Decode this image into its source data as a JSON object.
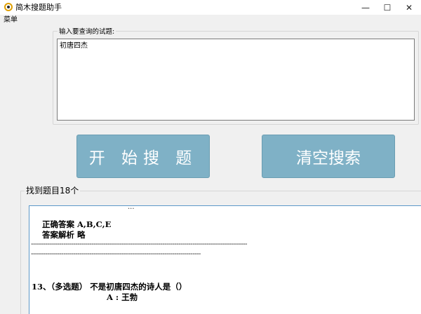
{
  "window": {
    "title": "简木搜题助手",
    "minimize_glyph": "—",
    "maximize_glyph": "☐",
    "close_glyph": "✕"
  },
  "menu": {
    "items": [
      "菜单"
    ]
  },
  "query": {
    "label": "输入要查询的试题:",
    "value": "初唐四杰"
  },
  "buttons": {
    "start": "开 始搜 题",
    "clear": "清空搜索"
  },
  "results": {
    "summary": "找到题目18个",
    "top_fragment": "...",
    "correct_answer": "正确答案 A,B,C,E",
    "analysis": "答案解析 略",
    "separator_1": "-----------------------------------------------------------------------------------------------------------",
    "separator_2": "------------------------------------------------------------------------------------",
    "question": "13、（多选题）  不是初唐四杰的诗人是（）",
    "option_a": "A : 王勃"
  },
  "colors": {
    "button_bg": "#7fb1c6",
    "results_border": "#5c98c9"
  }
}
